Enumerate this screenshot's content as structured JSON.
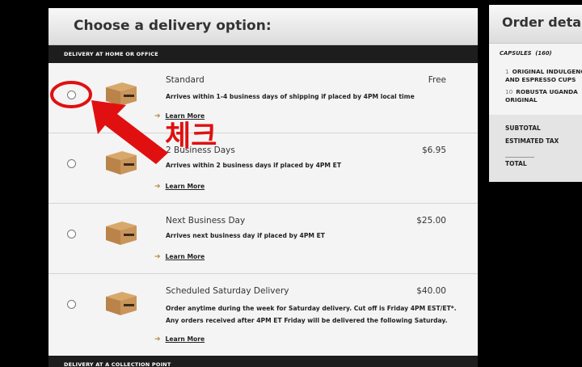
{
  "panel": {
    "title": "Choose a delivery option:",
    "section_home": "DELIVERY AT HOME OR OFFICE",
    "section_collection": "DELIVERY AT A COLLECTION POINT",
    "learn_more": "Learn More",
    "options": [
      {
        "name": "Standard",
        "price": "Free",
        "desc": [
          "Arrives within 1-4 business days of shipping if placed by 4PM local time"
        ]
      },
      {
        "name": "2 Business Days",
        "price": "$6.95",
        "desc": [
          "Arrives within 2 business days if placed by 4PM ET"
        ]
      },
      {
        "name": "Next Business Day",
        "price": "$25.00",
        "desc": [
          "Arrives next business day if placed by 4PM ET"
        ]
      },
      {
        "name": "Scheduled Saturday Delivery",
        "price": "$40.00",
        "desc": [
          "Order anytime during the week for Saturday delivery. Cut off is Friday 4PM EST/ET*.",
          "Any orders received after 4PM ET Friday will be delivered the following Saturday."
        ]
      }
    ]
  },
  "order": {
    "title": "Order details",
    "capsules_label": "CAPSULES",
    "capsules_count": "(160)",
    "items": [
      {
        "qty": "1",
        "lines": [
          "ORIGINAL INDULGENCE",
          "AND ESPRESSO CUPS"
        ]
      },
      {
        "qty": "10",
        "lines": [
          "ROBUSTA UGANDA",
          "ORIGINAL"
        ]
      }
    ],
    "subtotal": "SUBTOTAL",
    "tax": "ESTIMATED TAX",
    "total": "TOTAL"
  },
  "annotation": {
    "text": "체크",
    "color": "#e01010"
  },
  "colors": {
    "accent": "#b5893a",
    "section_bar": "#1d1d1d"
  }
}
